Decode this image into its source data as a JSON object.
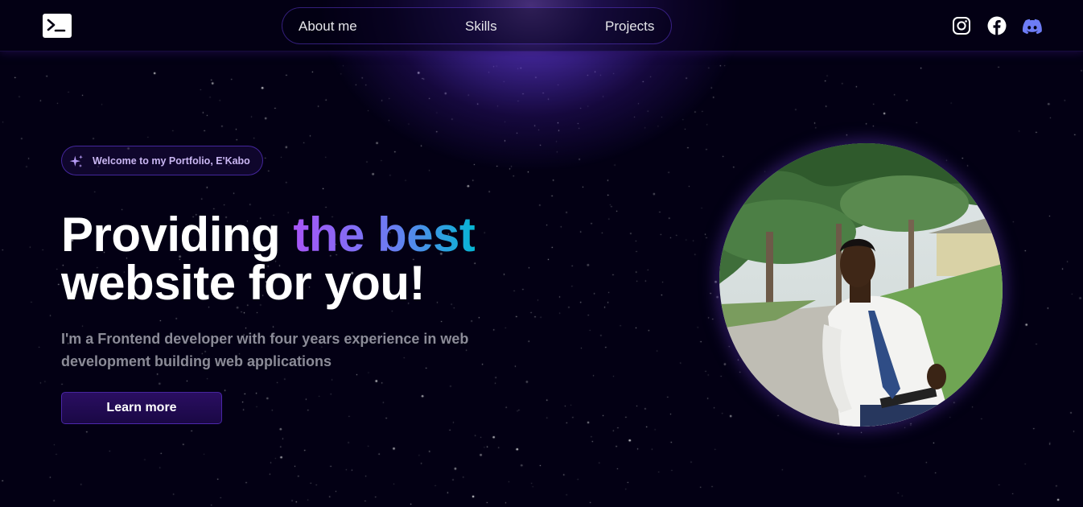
{
  "nav": {
    "links": [
      "About me",
      "Skills",
      "Projects"
    ],
    "logo_icon": "terminal-icon",
    "social_icons": [
      "instagram-icon",
      "facebook-icon",
      "discord-icon"
    ]
  },
  "hero": {
    "badge": "Welcome to my Portfolio, E'Kabo",
    "badge_icon": "sparkles-icon",
    "headline_start": "Providing ",
    "headline_highlight": "the best",
    "headline_end": "website for you!",
    "description": "I'm a Frontend developer with four years experience in web development building web applications",
    "cta": "Learn more"
  },
  "colors": {
    "background": "#030014",
    "accent": "#7042f8",
    "gradient_start": "#a855f7",
    "gradient_end": "#06b6d4",
    "discord": "#5865F2"
  }
}
